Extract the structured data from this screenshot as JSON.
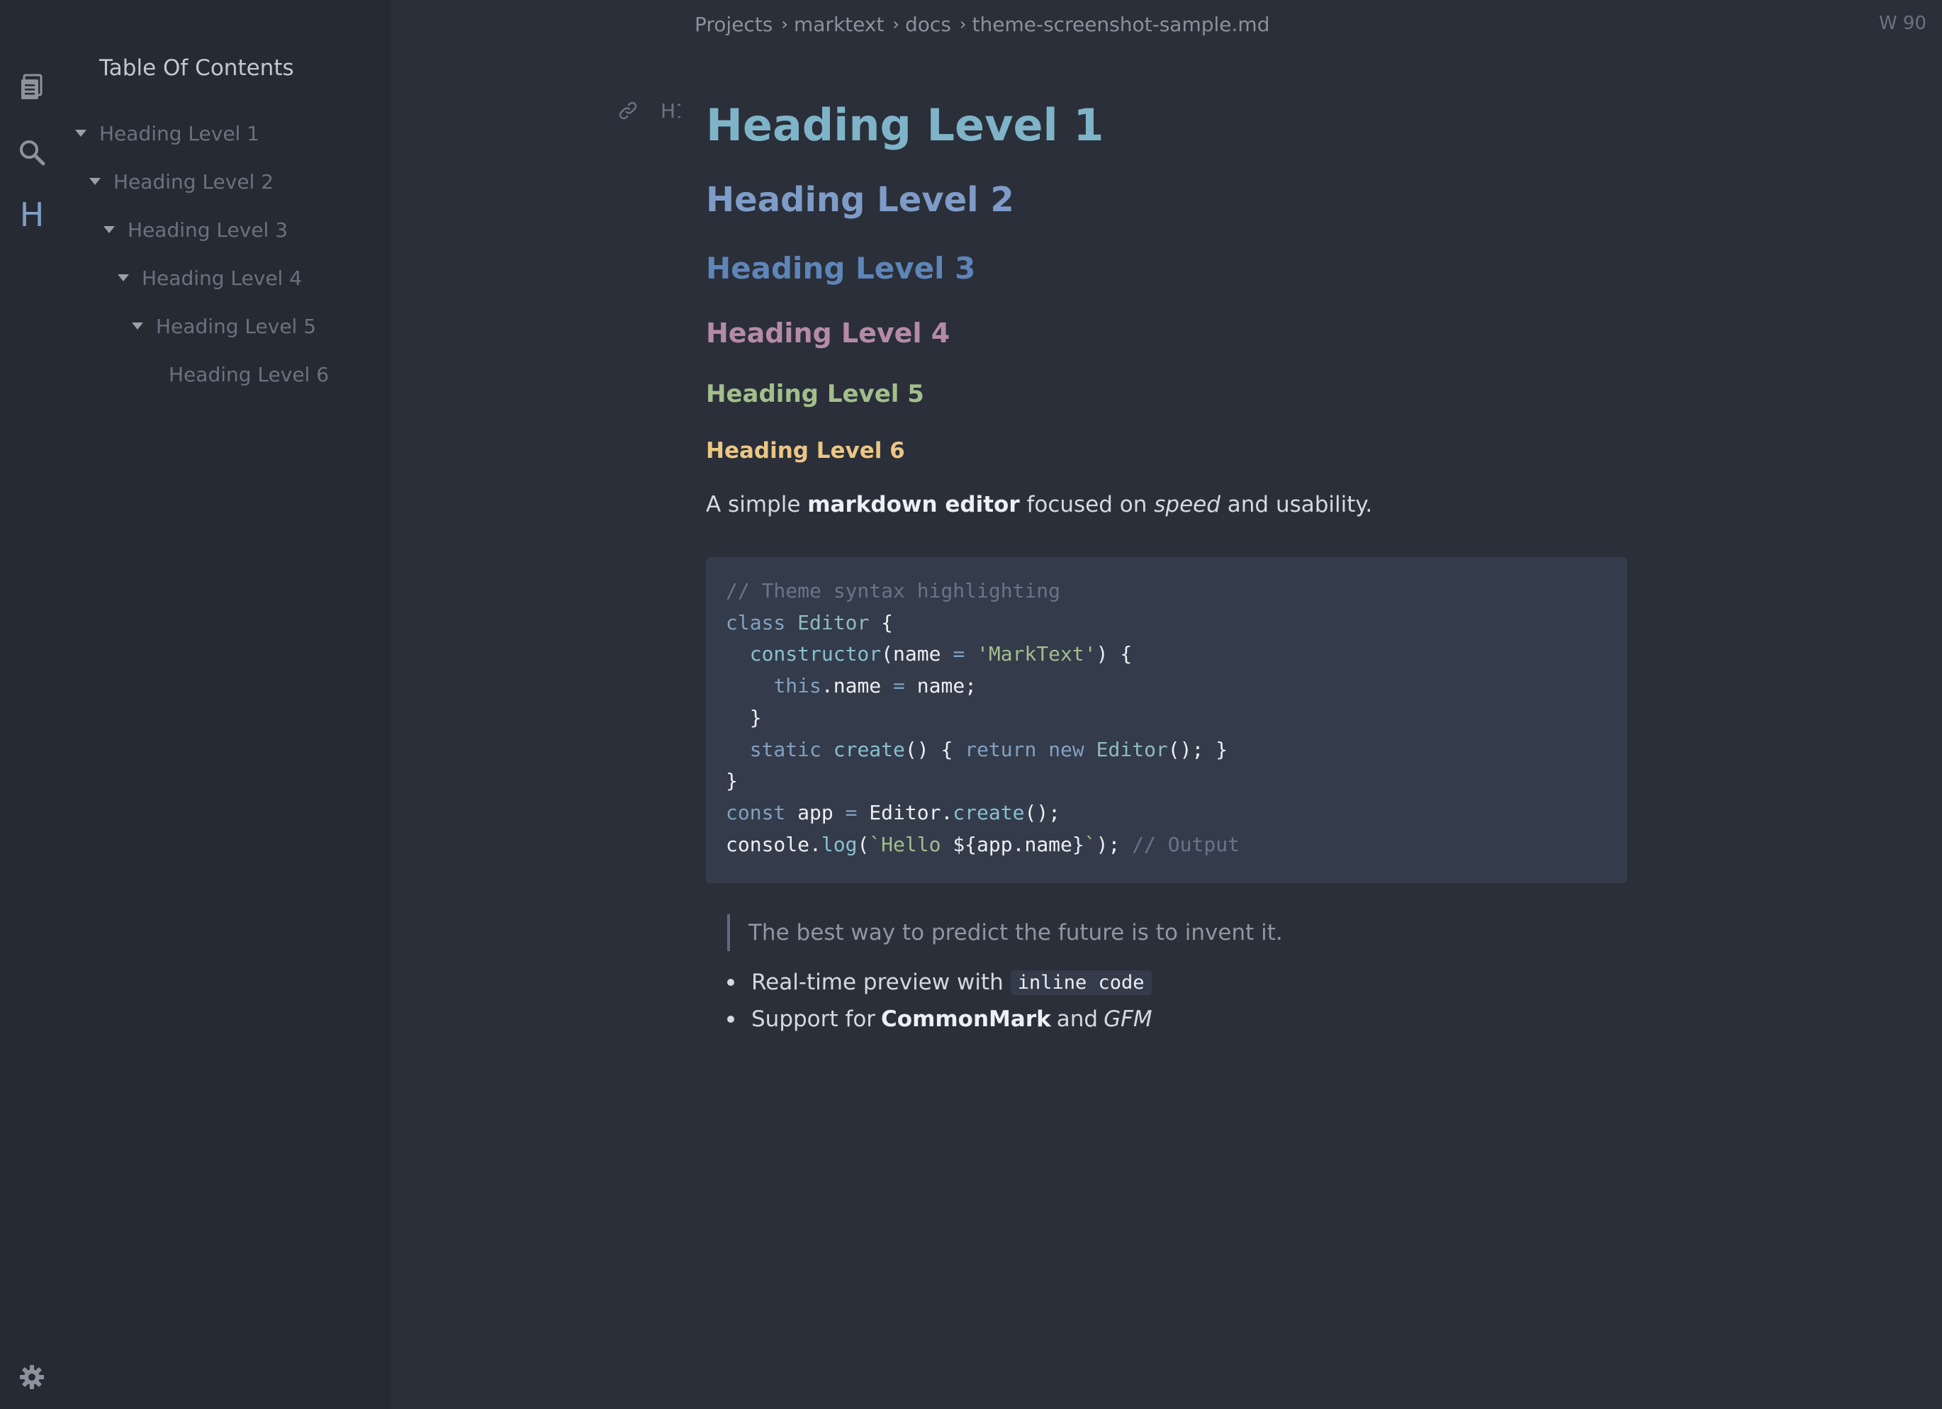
{
  "activity_bar": {
    "icons": [
      "files-icon",
      "search-icon",
      "toc-heading-icon",
      "settings-icon"
    ],
    "toc_glyph": "H"
  },
  "sidebar": {
    "title": "Table Of Contents",
    "items": [
      {
        "label": "Heading Level 1",
        "level": 1,
        "expandable": true
      },
      {
        "label": "Heading Level 2",
        "level": 2,
        "expandable": true
      },
      {
        "label": "Heading Level 3",
        "level": 3,
        "expandable": true
      },
      {
        "label": "Heading Level 4",
        "level": 4,
        "expandable": true
      },
      {
        "label": "Heading Level 5",
        "level": 5,
        "expandable": true
      },
      {
        "label": "Heading Level 6",
        "level": 6,
        "expandable": false
      }
    ]
  },
  "breadcrumb": [
    "Projects",
    "marktext",
    "docs",
    "theme-screenshot-sample.md"
  ],
  "word_count": "W 90",
  "editor": {
    "heading_tag": "H1",
    "headings": [
      "Heading Level 1",
      "Heading Level 2",
      "Heading Level 3",
      "Heading Level 4",
      "Heading Level 5",
      "Heading Level 6"
    ],
    "paragraph": {
      "text_1": "A simple ",
      "bold": "markdown editor",
      "text_2": " focused on ",
      "italic": "speed",
      "text_3": " and usability."
    },
    "code_lines": [
      "// Theme syntax highlighting",
      "class Editor {",
      "  constructor(name = 'MarkText') {",
      "    this.name = name;",
      "  }",
      "  static create() { return new Editor(); }",
      "}",
      "const app = Editor.create();",
      "console.log(`Hello ${app.name}`); // Output"
    ],
    "blockquote": "The best way to predict the future is to invent it.",
    "list": [
      {
        "text": "Real-time preview with ",
        "code": "inline code"
      },
      {
        "text": "Support for ",
        "bold": "CommonMark",
        "text_2": " and ",
        "italic": "GFM"
      }
    ]
  },
  "colors": {
    "background": "#2a2f39",
    "sidebar": "#262a33",
    "h1": "#7fb4c8",
    "h2": "#7e9cc7",
    "h3": "#5e85b8",
    "h4": "#b58aa9",
    "h5": "#a3be8c",
    "h6": "#ebc684",
    "code_bg": "#343b4a"
  }
}
